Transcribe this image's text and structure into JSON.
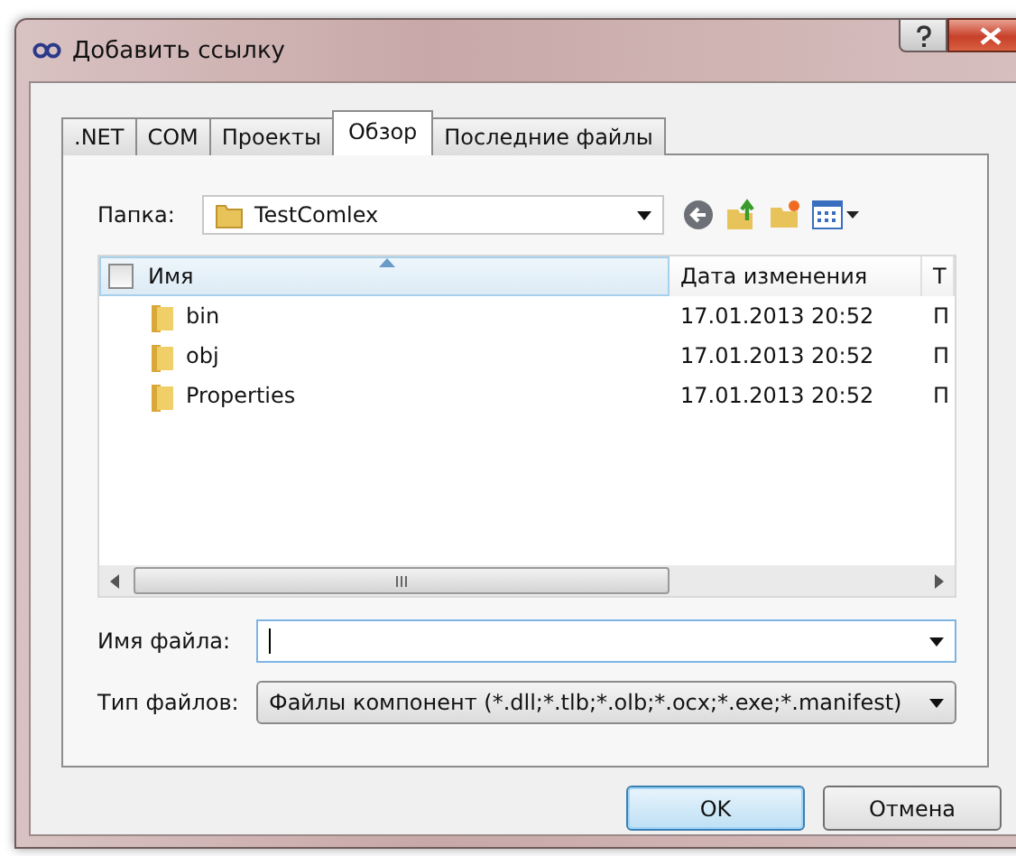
{
  "window": {
    "title": "Добавить ссылку"
  },
  "tabs": [
    {
      "label": ".NET",
      "selected": false
    },
    {
      "label": "COM",
      "selected": false
    },
    {
      "label": "Проекты",
      "selected": false
    },
    {
      "label": "Обзор",
      "selected": true
    },
    {
      "label": "Последние файлы",
      "selected": false
    }
  ],
  "folder": {
    "label": "Папка:",
    "value": "TestComlex"
  },
  "list": {
    "select_all_checked": false,
    "columns": [
      {
        "label": "Имя",
        "sorted": true
      },
      {
        "label": "Дата изменения",
        "sorted": false
      },
      {
        "label": "Т",
        "sorted": false
      }
    ],
    "rows": [
      {
        "name": "bin",
        "date": "17.01.2013 20:52",
        "column_3": "П"
      },
      {
        "name": "obj",
        "date": "17.01.2013 20:52",
        "column_3": "П"
      },
      {
        "name": "Properties",
        "date": "17.01.2013 20:52",
        "column_3": "П"
      }
    ]
  },
  "file_name": {
    "label": "Имя файла:"
  },
  "file_type": {
    "label": "Тип файлов:",
    "value": "Файлы компонент (*.dll;*.tlb;*.olb;*.ocx;*.exe;*.manifest)"
  },
  "buttons": [
    {
      "label": "OK",
      "kind": "default"
    },
    {
      "label": "Отмена",
      "kind": "normal"
    }
  ]
}
